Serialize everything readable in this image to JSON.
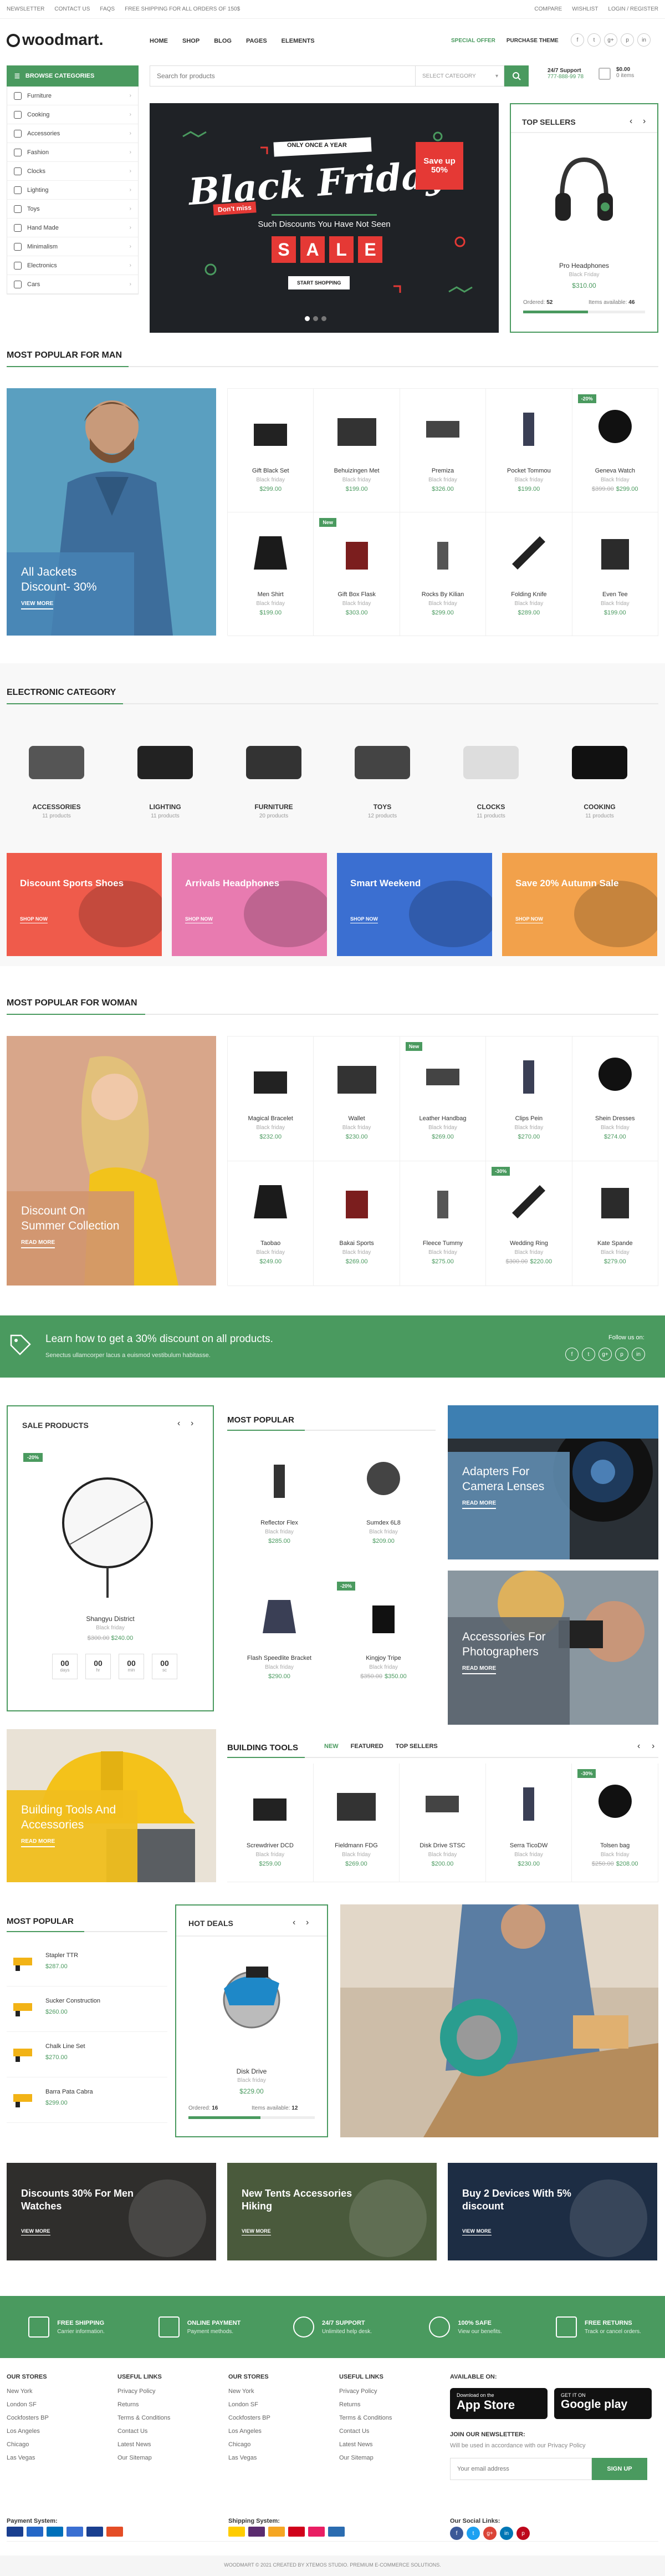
{
  "topbar": {
    "left": [
      "Newsletter",
      "Contact Us",
      "FAQs"
    ],
    "promo": "Free shipping for all orders of 150$",
    "right": [
      "Compare",
      "Wishlist",
      "Login / Register"
    ]
  },
  "brand": {
    "name": "woodmart."
  },
  "nav": [
    "Home",
    "Shop",
    "Blog",
    "Pages",
    "Elements"
  ],
  "header_links": [
    "Special Offer",
    "Purchase Theme"
  ],
  "social_top": [
    "f",
    "t",
    "g+",
    "p",
    "in"
  ],
  "categories": {
    "button": "Browse Categories",
    "items": [
      "Furniture",
      "Cooking",
      "Accessories",
      "Fashion",
      "Clocks",
      "Lighting",
      "Toys",
      "Hand Made",
      "Minimalism",
      "Electronics",
      "Cars"
    ]
  },
  "search": {
    "placeholder": "Search for products",
    "category": "Select Category"
  },
  "support": {
    "label": "24/7 Support",
    "phone": "777-888-99 78"
  },
  "cart": {
    "amount": "$0.00",
    "items": "0 items"
  },
  "hero": {
    "tag": "Only once a year",
    "title": "Black Friday",
    "subtitle_small": "Don't miss",
    "save": "Save up 50%",
    "tagline": "Such Discounts You Have Not Seen",
    "sale": "SALE",
    "cta": "Start Shopping"
  },
  "top_sellers": {
    "title": "Top Sellers",
    "product": "Pro Headphones",
    "category": "Black Friday",
    "price": "$310.00",
    "ordered_label": "Ordered:",
    "ordered": "52",
    "available_label": "Items available:",
    "available": "46"
  },
  "men": {
    "title": "Most Popular for Man",
    "banner": {
      "title": "All Jackets Discount- 30%",
      "cta": "View More"
    },
    "products": [
      {
        "name": "Gift Black Set",
        "cat": "Black friday",
        "price": "$299.00",
        "badge": ""
      },
      {
        "name": "Behuizingen Met",
        "cat": "Black friday",
        "price": "$199.00",
        "badge": ""
      },
      {
        "name": "Premiza",
        "cat": "Black friday",
        "price": "$326.00",
        "badge": ""
      },
      {
        "name": "Pocket Tommou",
        "cat": "Black friday",
        "price": "$199.00",
        "badge": ""
      },
      {
        "name": "Geneva Watch",
        "cat": "Black friday",
        "old": "$399.00",
        "price": "$299.00",
        "badge": "-20%"
      },
      {
        "name": "Men Shirt",
        "cat": "Black friday",
        "price": "$199.00",
        "badge": ""
      },
      {
        "name": "Gift Box Flask",
        "cat": "Black friday",
        "price": "$303.00",
        "badge": "New"
      },
      {
        "name": "Rocks By Kilian",
        "cat": "Black friday",
        "price": "$299.00",
        "badge": ""
      },
      {
        "name": "Folding Knife",
        "cat": "Black friday",
        "price": "$289.00",
        "badge": ""
      },
      {
        "name": "Even Tee",
        "cat": "Black friday",
        "price": "$199.00",
        "badge": ""
      }
    ]
  },
  "electronic": {
    "title": "Electronic Category",
    "items": [
      {
        "name": "Accessories",
        "count": "11 products"
      },
      {
        "name": "Lighting",
        "count": "11 products"
      },
      {
        "name": "Furniture",
        "count": "20 products"
      },
      {
        "name": "Toys",
        "count": "12 products"
      },
      {
        "name": "Clocks",
        "count": "11 products"
      },
      {
        "name": "Cooking",
        "count": "11 products"
      }
    ]
  },
  "promos": [
    {
      "title": "Discount Sports Shoes",
      "cta": "Shop Now",
      "color": "#ef5b4b"
    },
    {
      "title": "Arrivals Headphones",
      "cta": "Shop Now",
      "color": "#e87bb0"
    },
    {
      "title": "Smart Weekend",
      "cta": "Shop Now",
      "color": "#3b6fd1"
    },
    {
      "title": "Save 20% Autumn Sale",
      "cta": "Shop Now",
      "color": "#f2a14b"
    }
  ],
  "woman": {
    "title": "Most Popular for Woman",
    "banner": {
      "title": "Discount On Summer Collection",
      "cta": "Read More"
    },
    "products": [
      {
        "name": "Magical Bracelet",
        "cat": "Black friday",
        "price": "$232.00",
        "badge": ""
      },
      {
        "name": "Wallet",
        "cat": "Black friday",
        "price": "$230.00",
        "badge": ""
      },
      {
        "name": "Leather Handbag",
        "cat": "Black friday",
        "price": "$269.00",
        "badge": "New"
      },
      {
        "name": "Clips Pein",
        "cat": "Black friday",
        "price": "$270.00",
        "badge": ""
      },
      {
        "name": "Shein Dresses",
        "cat": "Black friday",
        "price": "$274.00",
        "badge": ""
      },
      {
        "name": "Taobao",
        "cat": "Black friday",
        "price": "$249.00",
        "badge": ""
      },
      {
        "name": "Bakai Sports",
        "cat": "Black friday",
        "price": "$269.00",
        "badge": ""
      },
      {
        "name": "Fleece Tummy",
        "cat": "Black friday",
        "price": "$275.00",
        "badge": ""
      },
      {
        "name": "Wedding Ring",
        "cat": "Black friday",
        "old": "$300.00",
        "price": "$220.00",
        "badge": "-30%"
      },
      {
        "name": "Kate Spande",
        "cat": "Black friday",
        "price": "$279.00",
        "badge": ""
      }
    ]
  },
  "discount_band": {
    "title": "Learn how to get a 30% discount on all products.",
    "sub": "Senectus ullamcorper lacus a euismod vestibulum habitasse.",
    "follow": "Follow us on:"
  },
  "sale_products": {
    "title": "Sale Products",
    "badge": "-20%",
    "product": "Shangyu District",
    "category": "Black friday",
    "old": "$300.00",
    "price": "$240.00",
    "timer": [
      {
        "v": "00",
        "l": "days"
      },
      {
        "v": "00",
        "l": "hr"
      },
      {
        "v": "00",
        "l": "min"
      },
      {
        "v": "00",
        "l": "sc"
      }
    ]
  },
  "most_popular_mid": {
    "title": "Most Popular",
    "products": [
      {
        "name": "Reflector Flex",
        "cat": "Black friday",
        "price": "$285.00",
        "badge": ""
      },
      {
        "name": "Sumdex 6L8",
        "cat": "Black friday",
        "price": "$209.00",
        "badge": ""
      },
      {
        "name": "Flash Speedlite Bracket",
        "cat": "Black friday",
        "price": "$290.00",
        "badge": ""
      },
      {
        "name": "Kingjoy Tripe",
        "cat": "Black friday",
        "old": "$350.00",
        "price": "$350.00",
        "badge": "-20%"
      }
    ]
  },
  "camera_banners": [
    {
      "title": "Adapters For Camera Lenses",
      "cta": "Read More"
    },
    {
      "title": "Accessories For Photographers",
      "cta": "Read More"
    }
  ],
  "building": {
    "banner": {
      "title": "Building Tools And Accessories",
      "cta": "Read More"
    },
    "title": "Building Tools",
    "tabs": [
      "New",
      "Featured",
      "Top Sellers"
    ],
    "products": [
      {
        "name": "Screwdriver DCD",
        "cat": "Black friday",
        "price": "$259.00",
        "badge": ""
      },
      {
        "name": "Fieldmann FDG",
        "cat": "Black friday",
        "price": "$269.00",
        "badge": ""
      },
      {
        "name": "Disk Drive STSC",
        "cat": "Black friday",
        "price": "$200.00",
        "badge": ""
      },
      {
        "name": "Serra TicoDW",
        "cat": "Black friday",
        "price": "$230.00",
        "badge": ""
      },
      {
        "name": "Tolsen bag",
        "cat": "Black friday",
        "old": "$250.00",
        "price": "$208.00",
        "badge": "-30%"
      }
    ]
  },
  "most_popular_list": {
    "title": "Most Popular",
    "items": [
      {
        "name": "Stapler TTR",
        "price": "$287.00"
      },
      {
        "name": "Sucker Construction",
        "price": "$260.00"
      },
      {
        "name": "Chalk Line Set",
        "price": "$270.00"
      },
      {
        "name": "Barra Pata Cabra",
        "price": "$299.00"
      }
    ]
  },
  "hot_deals": {
    "title": "Hot Deals",
    "product": "Disk Drive",
    "category": "Black friday",
    "price": "$229.00",
    "ordered_label": "Ordered:",
    "ordered": "16",
    "available_label": "Items available:",
    "available": "12"
  },
  "bottom_banners": [
    {
      "title": "Discounts 30% For Men Watches",
      "cta": "View More"
    },
    {
      "title": "New Tents Accessories Hiking",
      "cta": "View More"
    },
    {
      "title": "Buy 2 Devices With 5% discount",
      "cta": "View More"
    }
  ],
  "features": [
    {
      "title": "Free Shipping",
      "sub": "Carrier information."
    },
    {
      "title": "Online Payment",
      "sub": "Payment methods."
    },
    {
      "title": "24/7 Support",
      "sub": "Unlimited help desk."
    },
    {
      "title": "100% Safe",
      "sub": "View our benefits."
    },
    {
      "title": "Free Returns",
      "sub": "Track or cancel orders."
    }
  ],
  "footer": {
    "col1_title": "Our Stores",
    "col1": [
      "New York",
      "London SF",
      "Cockfosters BP",
      "Los Angeles",
      "Chicago",
      "Las Vegas"
    ],
    "col2_title": "Useful Links",
    "col2": [
      "Privacy Policy",
      "Returns",
      "Terms & Conditions",
      "Contact Us",
      "Latest News",
      "Our Sitemap"
    ],
    "col3_title": "Our Stores",
    "col3": [
      "New York",
      "London SF",
      "Cockfosters BP",
      "Los Angeles",
      "Chicago",
      "Las Vegas"
    ],
    "col4_title": "Useful Links",
    "col4": [
      "Privacy Policy",
      "Returns",
      "Terms & Conditions",
      "Contact Us",
      "Latest News",
      "Our Sitemap"
    ],
    "available_on": "Available On:",
    "appstore_small": "Download on the",
    "appstore": "App Store",
    "gplay_small": "GET IT ON",
    "gplay": "Google play",
    "newsletter_title": "Join our newsletter:",
    "newsletter_sub": "Will be used in accordance with our Privacy Policy",
    "email_placeholder": "Your email address",
    "signup": "Sign up",
    "payment": "Payment System:",
    "shipping": "Shipping System:",
    "social": "Our Social Links:",
    "copyright": "WOODMART © 2021 CREATED BY XTEMOS STUDIO. PREMIUM E-COMMERCE SOLUTIONS."
  },
  "colors": {
    "accent": "#4a9a5f",
    "red": "#e53935"
  }
}
